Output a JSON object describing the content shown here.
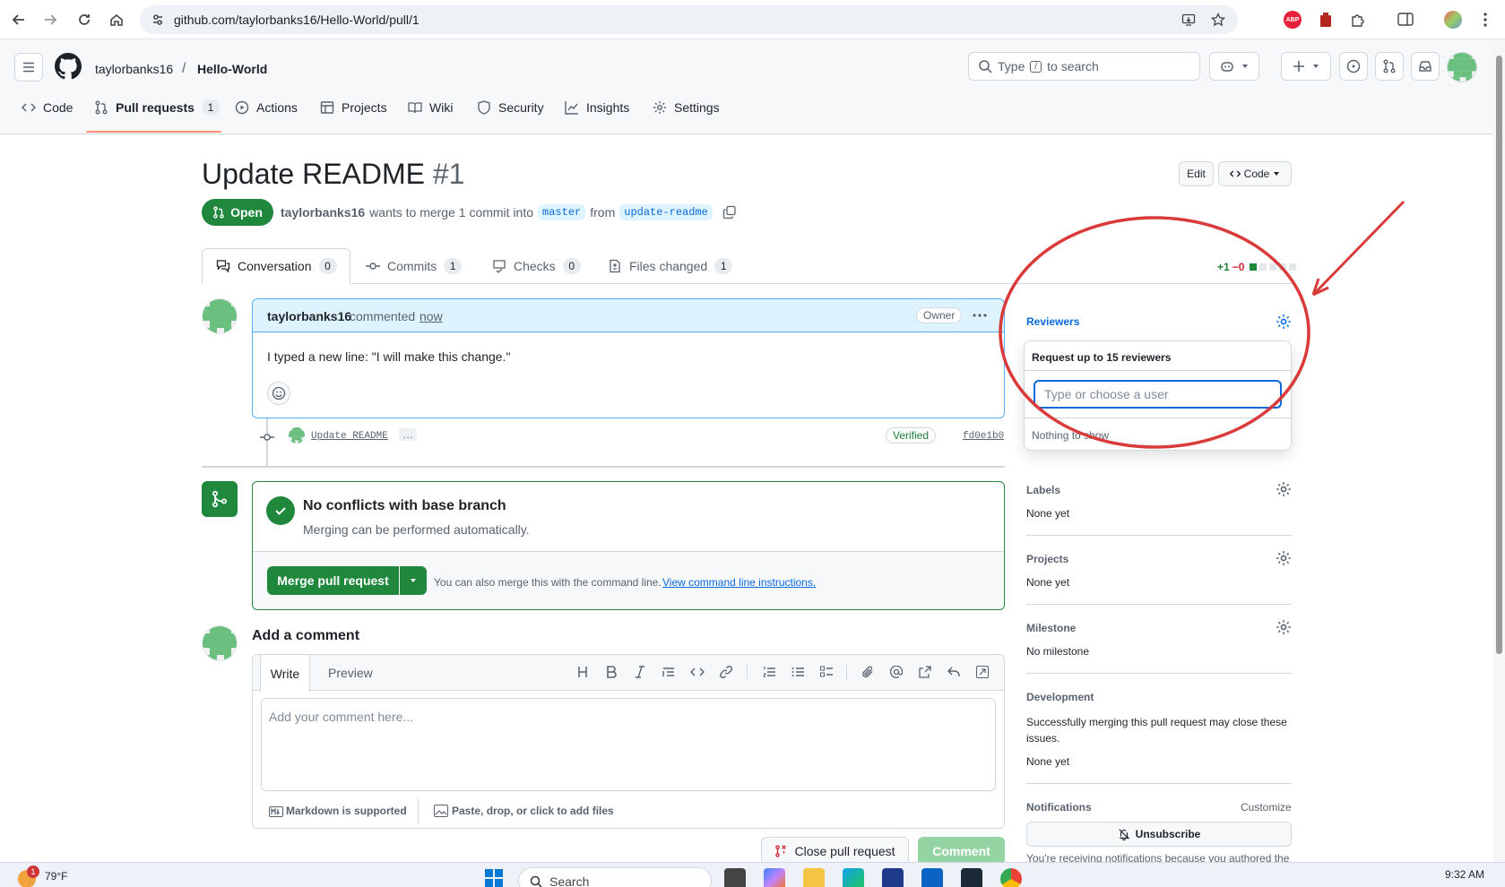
{
  "browser": {
    "url": "github.com/taylorbanks16/Hello-World/pull/1",
    "ext_abp": "ABP"
  },
  "header": {
    "owner": "taylorbanks16",
    "separator": "/",
    "repo": "Hello-World",
    "search_prefix": "Type",
    "search_key": "/",
    "search_suffix": "to search"
  },
  "repo_tabs": [
    {
      "label": "Code"
    },
    {
      "label": "Pull requests",
      "count": "1"
    },
    {
      "label": "Actions"
    },
    {
      "label": "Projects"
    },
    {
      "label": "Wiki"
    },
    {
      "label": "Security"
    },
    {
      "label": "Insights"
    },
    {
      "label": "Settings"
    }
  ],
  "pr": {
    "title": "Update README",
    "number": "#1",
    "edit_label": "Edit",
    "code_label": "Code",
    "state": "Open",
    "author": "taylorbanks16",
    "merge_text": "wants to merge 1 commit into",
    "base_branch": "master",
    "from_text": "from",
    "head_branch": "update-readme"
  },
  "pr_tabs": [
    {
      "label": "Conversation",
      "count": "0"
    },
    {
      "label": "Commits",
      "count": "1"
    },
    {
      "label": "Checks",
      "count": "0"
    },
    {
      "label": "Files changed",
      "count": "1"
    }
  ],
  "diffstat": {
    "added": "+1",
    "removed": "−0"
  },
  "comment": {
    "author": "taylorbanks16",
    "action": "commented",
    "time": "now",
    "role": "Owner",
    "body": "I typed a new line: \"I will make this change.\""
  },
  "commit": {
    "message": "Update README",
    "ellipsis": "…",
    "verified": "Verified",
    "sha": "fd0e1b0"
  },
  "merge": {
    "status_title": "No conflicts with base branch",
    "status_sub": "Merging can be performed automatically.",
    "button": "Merge pull request",
    "hint": "You can also merge this with the command line.",
    "hint_link": "View command line instructions."
  },
  "add_comment": {
    "title": "Add a comment",
    "tab_write": "Write",
    "tab_preview": "Preview",
    "placeholder": "Add your comment here...",
    "markdown_note": "Markdown is supported",
    "files_note": "Paste, drop, or click to add files",
    "close_button": "Close pull request",
    "comment_button": "Comment"
  },
  "sidebar": {
    "reviewers_title": "Reviewers",
    "dropdown_header": "Request up to 15 reviewers",
    "dropdown_placeholder": "Type or choose a user",
    "dropdown_empty": "Nothing to show",
    "labels_title": "Labels",
    "labels_value": "None yet",
    "projects_title": "Projects",
    "projects_value": "None yet",
    "milestone_title": "Milestone",
    "milestone_value": "No milestone",
    "development_title": "Development",
    "development_text": "Successfully merging this pull request may close these issues.",
    "development_value": "None yet",
    "notifications_title": "Notifications",
    "notifications_customize": "Customize",
    "unsubscribe": "Unsubscribe",
    "notifications_footer": "You're receiving notifications because you authored the"
  },
  "taskbar": {
    "weather": "79°F",
    "weather_badge": "1",
    "search": "Search",
    "time": "9:32 AM"
  },
  "colors": {
    "accent": "#0969da",
    "success": "#1f883d",
    "annotation": "#d93a3a"
  }
}
